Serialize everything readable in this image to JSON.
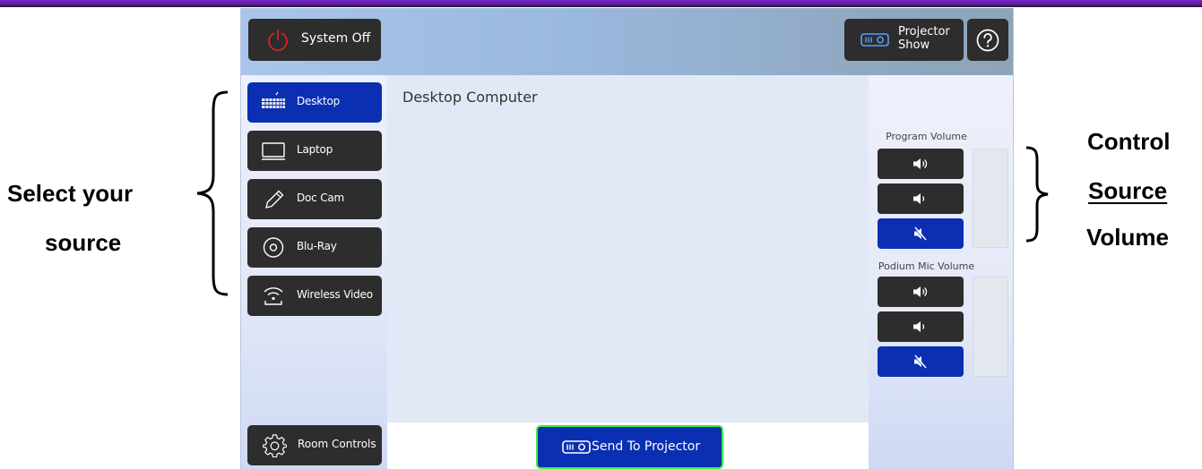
{
  "header": {
    "system_off_label": "System Off",
    "projector_show_label": "Projector\nShow",
    "help_icon": "question-mark-icon"
  },
  "sources": [
    {
      "label": "Desktop",
      "icon": "keyboard-icon",
      "selected": true
    },
    {
      "label": "Laptop",
      "icon": "laptop-icon",
      "selected": false
    },
    {
      "label": "Doc Cam",
      "icon": "pencil-icon",
      "selected": false
    },
    {
      "label": "Blu-Ray",
      "icon": "disc-icon",
      "selected": false
    },
    {
      "label": "Wireless Video",
      "icon": "wireless-icon",
      "selected": false
    }
  ],
  "room_controls_label": "Room Controls",
  "main": {
    "title": "Desktop Computer",
    "send_label": "Send To Projector"
  },
  "volume": {
    "program_title": "Program Volume",
    "podium_title": "Podium Mic Volume"
  },
  "annotations": {
    "left_line1": "Select your",
    "left_line2": "source",
    "right_line1": "Control",
    "right_line2": "Source",
    "right_line3": "Volume"
  },
  "colors": {
    "selected_blue": "#0b2fb3",
    "dark_button": "#2d2d2d",
    "send_border": "#3cf03c",
    "power_red": "#e02020",
    "top_stripe": "#7a27c4"
  }
}
